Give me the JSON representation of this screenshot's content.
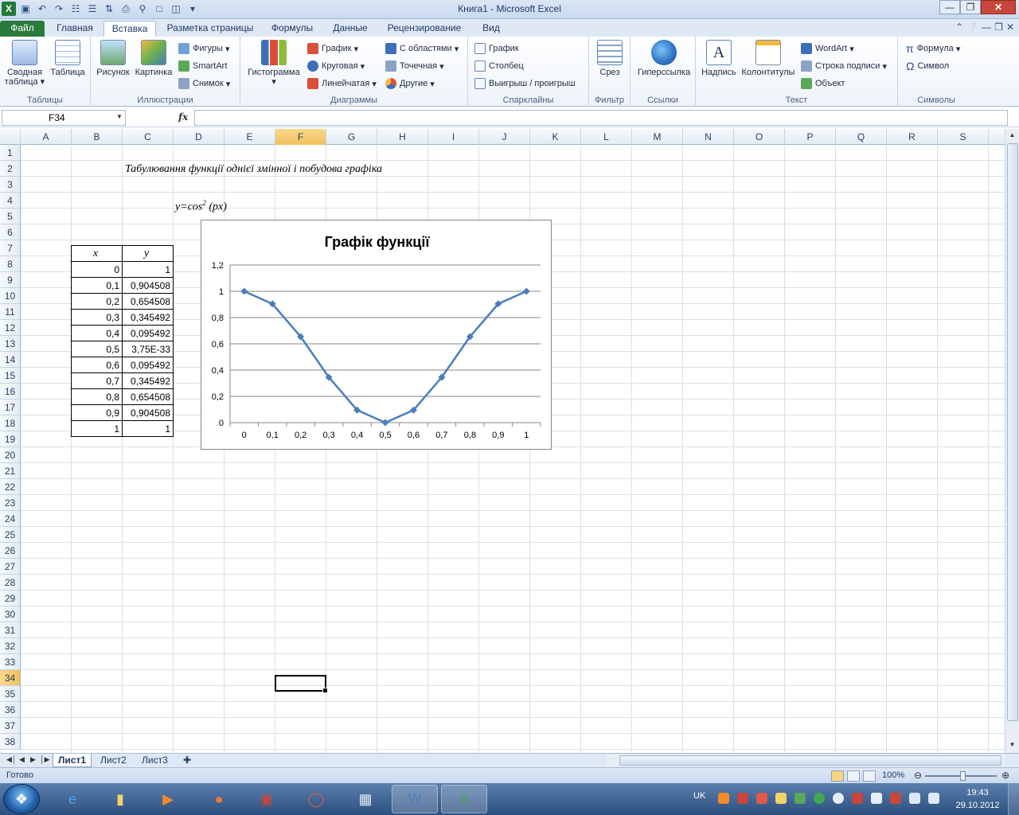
{
  "window": {
    "title": "Книга1  -  Microsoft Excel",
    "logo": "X"
  },
  "tabs": {
    "file": "Файл",
    "items": [
      "Главная",
      "Вставка",
      "Разметка страницы",
      "Формулы",
      "Данные",
      "Рецензирование",
      "Вид"
    ],
    "active": "Вставка"
  },
  "ribbon": {
    "tables": {
      "label": "Таблицы",
      "pivot": "Сводная таблица",
      "table": "Таблица"
    },
    "illustrations": {
      "label": "Иллюстрации",
      "picture": "Рисунок",
      "clipart": "Картинка",
      "shapes": "Фигуры",
      "smartart": "SmartArt",
      "screenshot": "Снимок"
    },
    "charts": {
      "label": "Диаграммы",
      "histogram": "Гистограмма",
      "line": "График",
      "pie": "Круговая",
      "bar": "Линейчатая",
      "area": "С областями",
      "scatter": "Точечная",
      "other": "Другие"
    },
    "sparklines": {
      "label": "Спарклайны",
      "line": "График",
      "column": "Столбец",
      "winloss": "Выигрыш / проигрыш"
    },
    "filter": {
      "label": "Фильтр",
      "slicer": "Срез"
    },
    "links": {
      "label": "Ссылки",
      "hyperlink": "Гиперссылка"
    },
    "text": {
      "label": "Текст",
      "textbox": "Надпись",
      "headerfooter": "Колонтитулы",
      "wordart": "WordArt",
      "signature": "Строка подписи",
      "object": "Объект"
    },
    "symbols": {
      "label": "Символы",
      "equation": "Формула",
      "symbol": "Символ"
    }
  },
  "formula_bar": {
    "name_box": "F34",
    "fx": "fx",
    "value": ""
  },
  "columns": [
    "A",
    "B",
    "C",
    "D",
    "E",
    "F",
    "G",
    "H",
    "I",
    "J",
    "K",
    "L",
    "M",
    "N",
    "O",
    "P",
    "Q",
    "R",
    "S"
  ],
  "rows": [
    "1",
    "2",
    "3",
    "4",
    "5",
    "6",
    "7",
    "8",
    "9",
    "10",
    "11",
    "12",
    "13",
    "14",
    "15",
    "16",
    "17",
    "18",
    "19",
    "20",
    "21",
    "22",
    "23",
    "24",
    "25",
    "26",
    "27",
    "28",
    "29",
    "30",
    "31",
    "32",
    "33",
    "34",
    "35",
    "36",
    "37",
    "38"
  ],
  "selected": {
    "column": "F",
    "row": "34"
  },
  "sheet": {
    "title": "Табулювання функції однієї змінної і побудова графіка",
    "formula_main": "y=cos",
    "formula_sup": "2",
    "formula_rest": " (px)",
    "table_headers": [
      "x",
      "y"
    ],
    "table_rows": [
      [
        "0",
        "1"
      ],
      [
        "0,1",
        "0,904508"
      ],
      [
        "0,2",
        "0,654508"
      ],
      [
        "0,3",
        "0,345492"
      ],
      [
        "0,4",
        "0,095492"
      ],
      [
        "0,5",
        "3,75E-33"
      ],
      [
        "0,6",
        "0,095492"
      ],
      [
        "0,7",
        "0,345492"
      ],
      [
        "0,8",
        "0,654508"
      ],
      [
        "0,9",
        "0,904508"
      ],
      [
        "1",
        "1"
      ]
    ]
  },
  "chart_data": {
    "type": "line",
    "title": "Графік функції",
    "categories": [
      "0",
      "0,1",
      "0,2",
      "0,3",
      "0,4",
      "0,5",
      "0,6",
      "0,7",
      "0,8",
      "0,9",
      "1"
    ],
    "series": [
      {
        "values": [
          1,
          0.904508,
          0.654508,
          0.345492,
          0.095492,
          0,
          0.095492,
          0.345492,
          0.654508,
          0.904508,
          1
        ],
        "color": "#4a7ebb"
      }
    ],
    "y_ticks": [
      "0",
      "0,2",
      "0,4",
      "0,6",
      "0,8",
      "1",
      "1,2"
    ],
    "ylim": [
      0,
      1.2
    ],
    "grid": true,
    "legend": "none"
  },
  "sheet_tabs": [
    "Лист1",
    "Лист2",
    "Лист3"
  ],
  "active_sheet": "Лист1",
  "status": {
    "text": "Готово",
    "zoom": "100%"
  },
  "taskbar": {
    "lang": "UK",
    "time": "19:43",
    "date": "29.10.2012"
  }
}
